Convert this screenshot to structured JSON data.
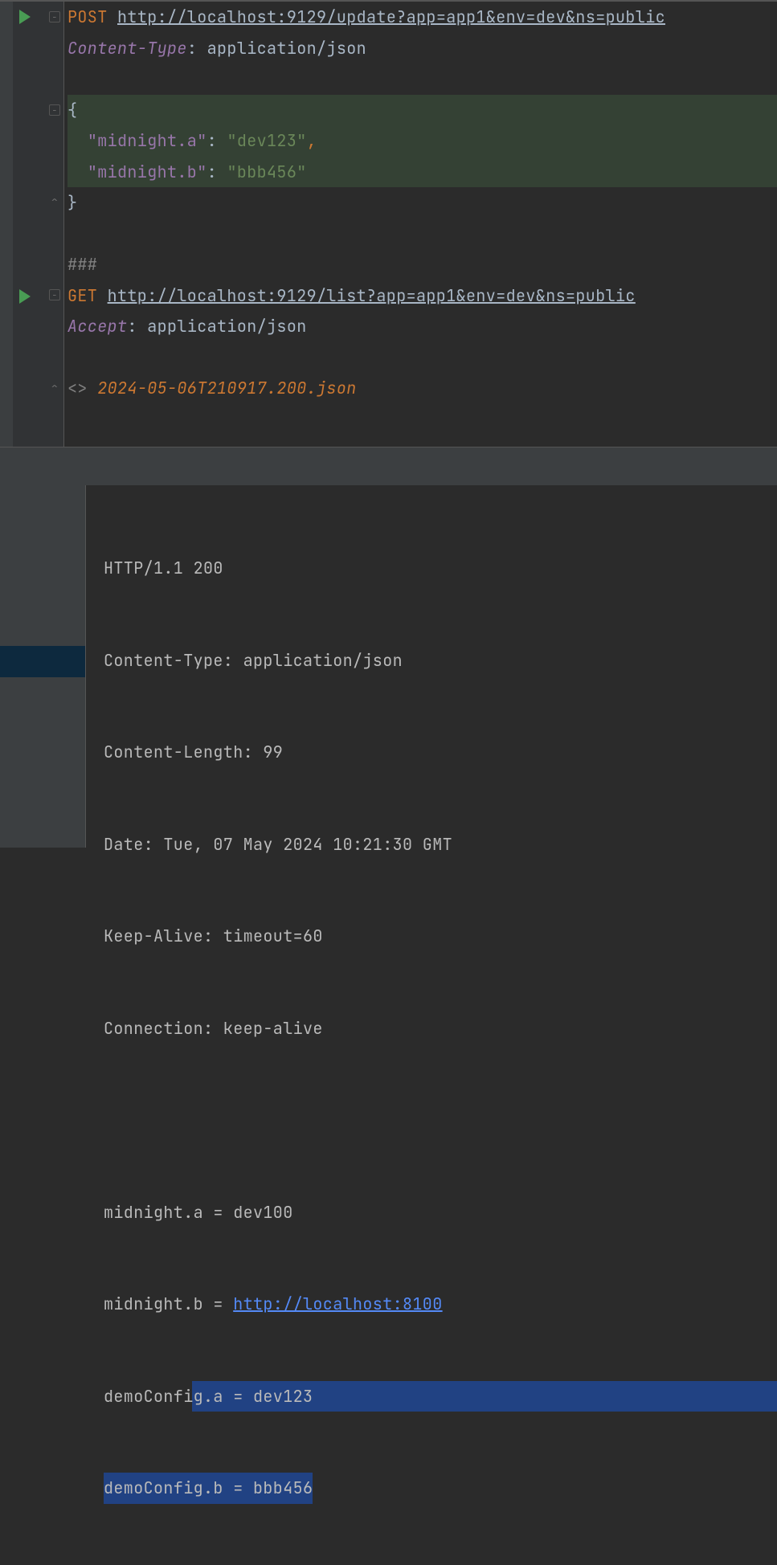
{
  "editor": {
    "lines": [
      {
        "type": "request",
        "method": "POST",
        "url": "http://localhost:9129/update?app=app1&env=dev&ns=public",
        "run": true,
        "fold": "start"
      },
      {
        "type": "header",
        "name": "Content-Type",
        "value": "application/json"
      },
      {
        "type": "blank"
      },
      {
        "type": "json",
        "text": "{",
        "fold": "start",
        "hl": true
      },
      {
        "type": "json-kv",
        "key": "\"midnight.a\"",
        "val": "\"dev123\"",
        "comma": true,
        "hl": true
      },
      {
        "type": "json-kv",
        "key": "\"midnight.b\"",
        "val": "\"bbb456\"",
        "comma": false,
        "hl": true
      },
      {
        "type": "json",
        "text": "}",
        "fold": "end"
      },
      {
        "type": "blank"
      },
      {
        "type": "sep",
        "text": "###"
      },
      {
        "type": "request",
        "method": "GET",
        "url": "http://localhost:9129/list?app=app1&env=dev&ns=public",
        "run": true,
        "fold": "start"
      },
      {
        "type": "header",
        "name": "Accept",
        "value": "application/json"
      },
      {
        "type": "blank"
      },
      {
        "type": "resp-file",
        "marker": "<>",
        "file": "2024-05-06T210917.200.json",
        "fold": "end"
      },
      {
        "type": "blank"
      }
    ]
  },
  "response": {
    "statusLine": "HTTP/1.1 200",
    "headers": [
      "Content-Type: application/json",
      "Content-Length: 99",
      "Date: Tue, 07 May 2024 10:21:30 GMT",
      "Keep-Alive: timeout=60",
      "Connection: keep-alive"
    ],
    "body": {
      "line1": "midnight.a = dev100",
      "line2_prefix": "midnight.b = ",
      "line2_link": "http://localhost:8100",
      "line3": "demoConfig.a = dev123",
      "line4": "demoConfig.b = bbb456"
    }
  }
}
